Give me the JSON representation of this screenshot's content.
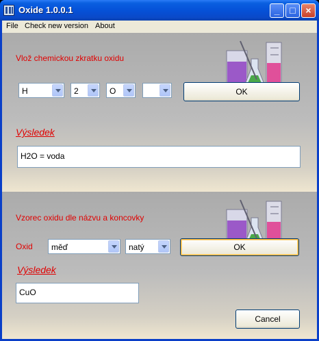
{
  "window": {
    "title": "Oxide 1.0.0.1",
    "minimize_glyph": "_",
    "maximize_glyph": "□",
    "close_glyph": "×"
  },
  "menu": {
    "items": [
      "File",
      "Check new version",
      "About"
    ]
  },
  "section1": {
    "prompt": "Vlož chemickou zkratku oxidu",
    "combos": [
      "H",
      "2",
      "O",
      ""
    ],
    "ok_label": "OK",
    "result_heading": "Výsledek",
    "result_value": "H2O = voda"
  },
  "section2": {
    "prompt": "Vzorec oxidu dle názvu a koncovky",
    "oxid_label": "Oxid",
    "name_value": "měď",
    "suffix_value": "natý",
    "ok_label": "OK",
    "result_heading": "Výsledek",
    "result_value": "CuO",
    "cancel_label": "Cancel"
  },
  "colors": {
    "titlebar": "#0a5fe0",
    "red_text": "#e00000",
    "flask_purple": "#9b59c8",
    "flask_green": "#4aa84a",
    "flask_pink": "#e0509a"
  },
  "icons": [
    "app-icon",
    "minimize-icon",
    "maximize-icon",
    "close-icon",
    "chevron-down-icon",
    "lab-glassware-icon"
  ]
}
